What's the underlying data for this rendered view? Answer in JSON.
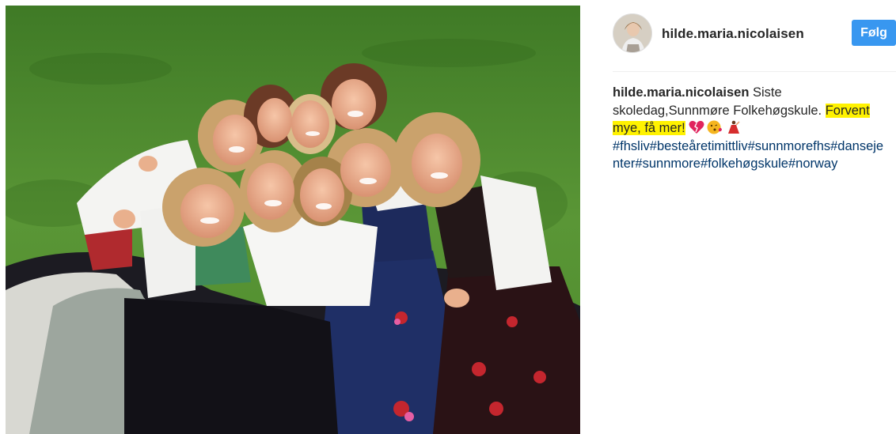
{
  "post": {
    "username": "hilde.maria.nicolaisen",
    "follow_label": "Følg",
    "photo_alt": "",
    "caption": {
      "username": "hilde.maria.nicolaisen",
      "text_plain": " Siste skoledag,Sunnmøre Folkehøgskule. ",
      "text_highlight": "Forvent mye, få mer!",
      "emojis": [
        "heart-broken-emoji",
        "kissing-face-emoji",
        "dancer-emoji"
      ],
      "hashtags": "#fhsliv#besteåretimittliv#sunnmorefhs#dansejenter#sunnmore#folkehøgskule#norway"
    }
  },
  "colors": {
    "follow_bg": "#3897f0",
    "highlight": "#fff200",
    "hashtag": "#003569",
    "grass": "#4d8a2e"
  }
}
